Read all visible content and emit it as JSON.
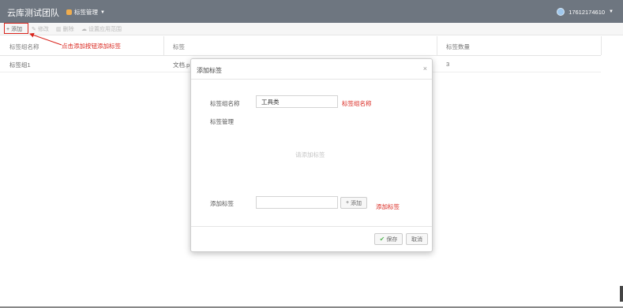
{
  "header": {
    "team_title": "云库测试团队",
    "menu_label": "标签管理",
    "user_phone": "17612174610"
  },
  "toolbar": {
    "add": "添加",
    "edit": "修改",
    "delete": "删除",
    "scope": "设置应用范围"
  },
  "table": {
    "columns": [
      "标签组名称",
      "标签",
      "标签数量"
    ],
    "rows": [
      {
        "name": "标签组1",
        "tags": "文档.p",
        "count": "3"
      }
    ]
  },
  "annotations": {
    "add_hint": "点击添加按钮添加标签",
    "group_name_hint": "标签组名称",
    "add_tag_hint": "添加标签"
  },
  "modal": {
    "title": "添加标签",
    "close": "×",
    "group_name_label": "标签组名称",
    "group_name_value": "工具类",
    "tag_manage_label": "标签管理",
    "empty_hint": "请添加标签",
    "add_tag_label": "添加标签",
    "add_tag_value": "",
    "add_button": "添加",
    "save_button": "保存",
    "cancel_button": "取消"
  },
  "colors": {
    "header_bg": "#6e7680",
    "annotation": "#d9251d",
    "save_check": "#5cb85c"
  }
}
